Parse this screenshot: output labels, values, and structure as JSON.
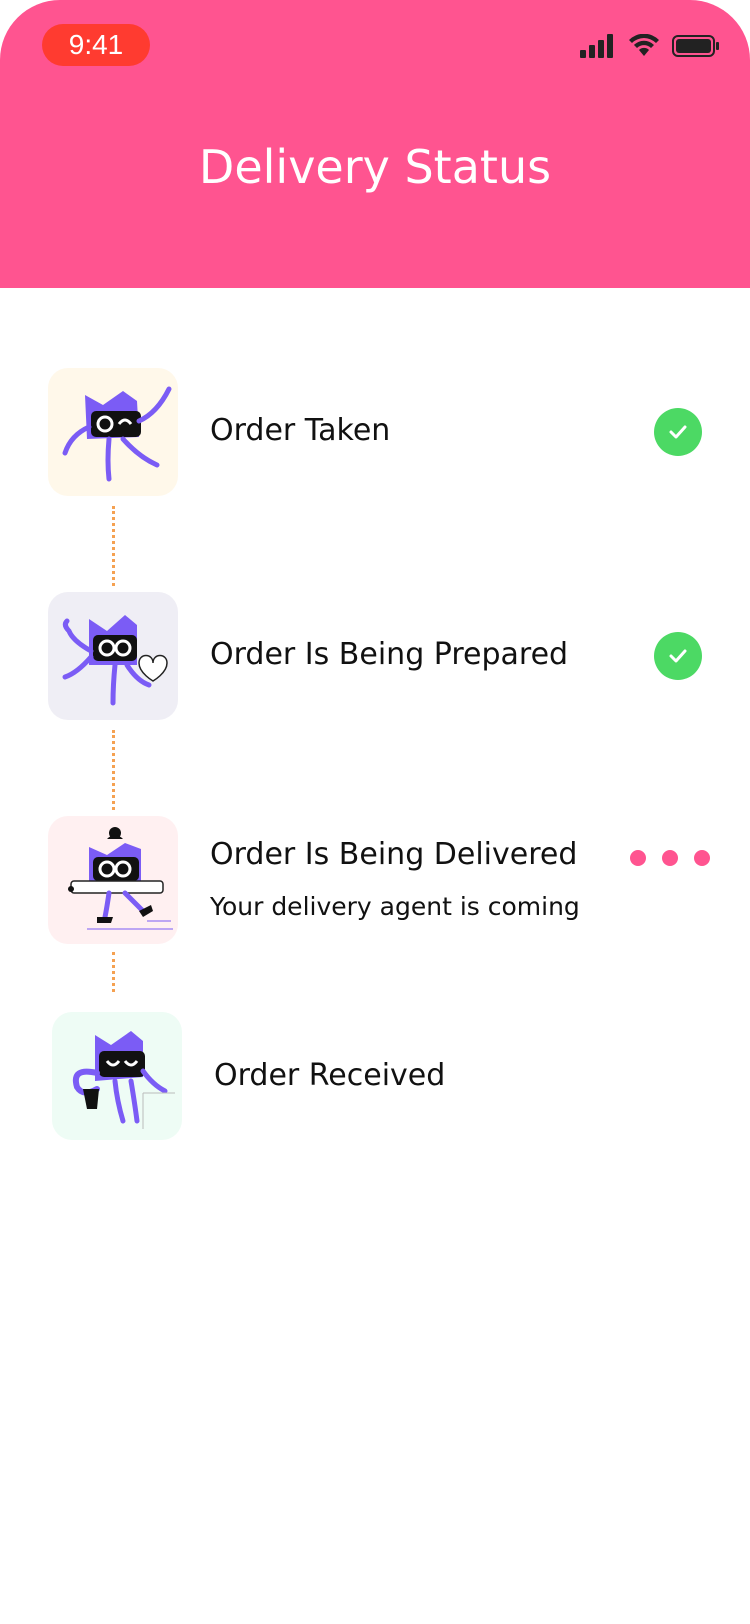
{
  "status_bar": {
    "time": "9:41",
    "icons": [
      "signal-icon",
      "wifi-icon",
      "battery-icon"
    ]
  },
  "header": {
    "title": "Delivery Status"
  },
  "steps": [
    {
      "label": "Order Taken",
      "subtitle": "",
      "state": "done",
      "icon": "mascot-dancing-icon",
      "bg": "#FFF8EA"
    },
    {
      "label": "Order Is Being Prepared",
      "subtitle": "",
      "state": "done",
      "icon": "mascot-heart-icon",
      "bg": "#EFEEF5"
    },
    {
      "label": "Order Is Being Delivered",
      "subtitle": "Your delivery agent is coming",
      "state": "in-progress",
      "icon": "mascot-skating-icon",
      "bg": "#FFF0F1"
    },
    {
      "label": "Order Received",
      "subtitle": "",
      "state": "pending",
      "icon": "mascot-shopping-icon",
      "bg": "#EEFCF5"
    }
  ],
  "colors": {
    "accent": "#FF5490",
    "check": "#4CD964",
    "connector": "#F5A151",
    "mascot": "#7B5CF5"
  }
}
